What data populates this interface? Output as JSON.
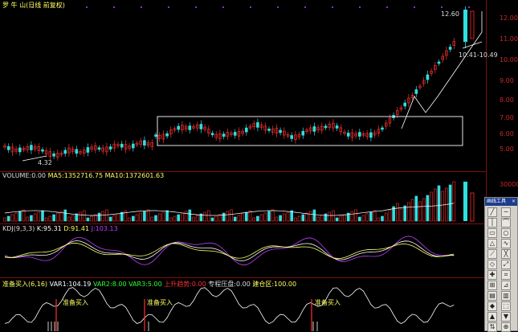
{
  "chart_header": {
    "stock_name": "罗 牛 山",
    "period": "(日线 前复权)"
  },
  "price_panel": {
    "y_ticks": [
      "12.00",
      "11.00",
      "10.00",
      "9.00",
      "8.00",
      "7.00",
      "6.00",
      "5.00"
    ],
    "low_label": "4.32",
    "high_label": "12.60",
    "range_label": "10.41-10.49"
  },
  "volume_panel": {
    "title": "VOLUME:0.00",
    "ma5": "MA5:1352716.75",
    "ma10": "MA10:1372601.63",
    "y_tick": "30000"
  },
  "kdj_panel": {
    "title": "KDJ(9,3,3)",
    "k": "K:95.31",
    "d": "D:91.41",
    "j": "J:103.13"
  },
  "indicator_panel": {
    "title": "准备买入(6,16)",
    "var1": "VAR1:104.19",
    "var2": "VAR2:8.00",
    "var3": "VAR3:5.00",
    "s1": "上升趋势:0.00",
    "s2": "专程压盘:0.00",
    "s3": "建仓区:100.00",
    "signal1": "准备买入",
    "signal2": "准备买入",
    "signal3": "准备买入"
  },
  "toolbar": {
    "title": "画线工具",
    "close": "×"
  },
  "colors": {
    "up": "#ff3030",
    "down": "#30e0e0",
    "grid": "#7a1010",
    "box": "#ffffff",
    "k": "#ffffff",
    "d": "#ffff60",
    "j": "#c040ff"
  }
}
